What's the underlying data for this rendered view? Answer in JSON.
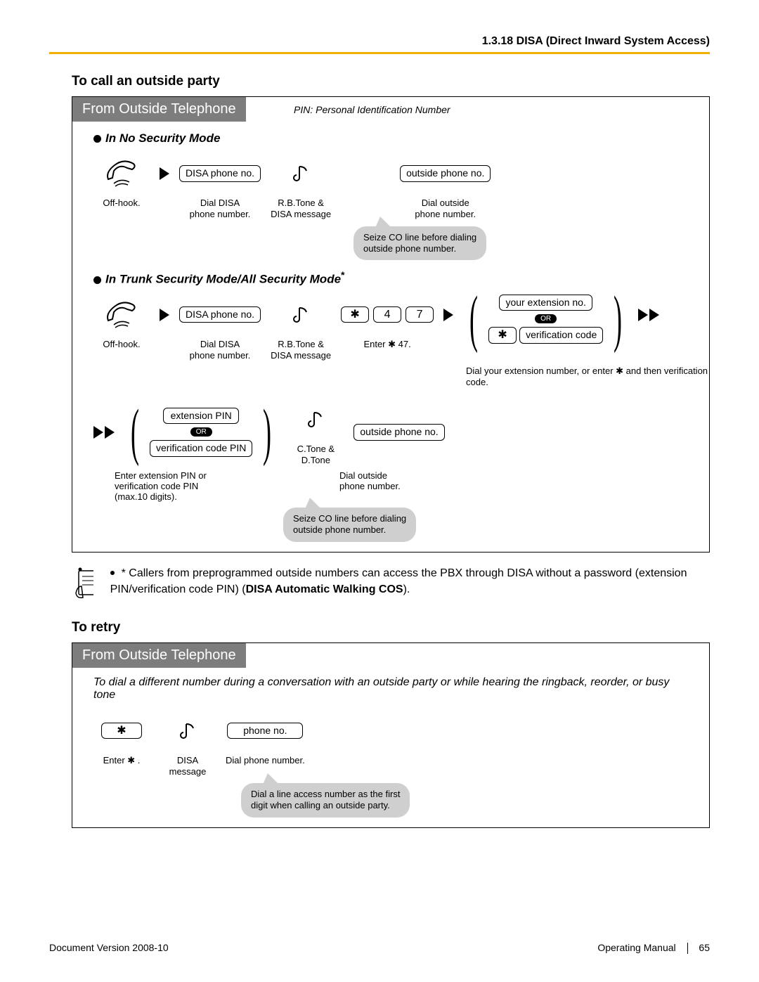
{
  "header": {
    "section": "1.3.18 DISA (Direct Inward System Access)"
  },
  "headings": {
    "call_outside": "To call an outside party",
    "to_retry": "To retry"
  },
  "panel1": {
    "title": "From Outside Telephone",
    "pin_note": "PIN: Personal Identification Number",
    "mode1": {
      "label": "In No Security Mode",
      "offhook": "Off-hook.",
      "disa_box": "DISA\nphone no.",
      "disa_caption": "Dial DISA\nphone number.",
      "rb_tone": "R.B.Tone &\nDISA message",
      "outside_box": "outside\nphone no.",
      "outside_caption": "Dial outside\nphone number.",
      "callout": "Seize CO line before dialing\noutside phone number."
    },
    "mode2": {
      "label": "In Trunk Security Mode/All Security Mode",
      "star_sup": "*",
      "offhook": "Off-hook.",
      "disa_box": "DISA\nphone no.",
      "disa_caption": "Dial DISA\nphone number.",
      "rb_tone": "R.B.Tone &\nDISA message",
      "key_star": "✱",
      "key_4": "4",
      "key_7": "7",
      "enter47": "Enter ✱ 47.",
      "ext_box": "your\nextension no.",
      "ver_box_row1": "✱",
      "ver_box_row1b": "verification\ncode",
      "or": "OR",
      "ext_caption": "Dial your extension number,\nor enter ✱ and then verification\ncode.",
      "pin_ext": "extension PIN",
      "pin_ver": "verification code PIN",
      "pin_caption": "Enter extension PIN or\nverification code PIN\n(max.10 digits).",
      "c_tone": "C.Tone &\nD.Tone",
      "outside_box": "outside\nphone no.",
      "outside_caption": "Dial outside\nphone number.",
      "callout": "Seize CO line before dialing\noutside phone number."
    }
  },
  "note": {
    "text1": "* Callers from preprogrammed outside numbers can access the PBX through DISA without a password (extension PIN/verification code PIN) (",
    "bold": "DISA Automatic Walking COS",
    "text2": ")."
  },
  "panel2": {
    "title": "From Outside Telephone",
    "intro": "To dial a different number during a conversation with an outside party or while hearing the ringback, reorder, or busy tone",
    "key_star": "✱",
    "enter_star": "Enter ✱ .",
    "disa_msg": "DISA\nmessage",
    "phone_box": "phone no.",
    "dial_caption": "Dial phone number.",
    "callout": "Dial a line access number as the first\ndigit when calling an outside party."
  },
  "footer": {
    "left": "Document Version  2008-10",
    "right1": "Operating Manual",
    "page": "65"
  }
}
